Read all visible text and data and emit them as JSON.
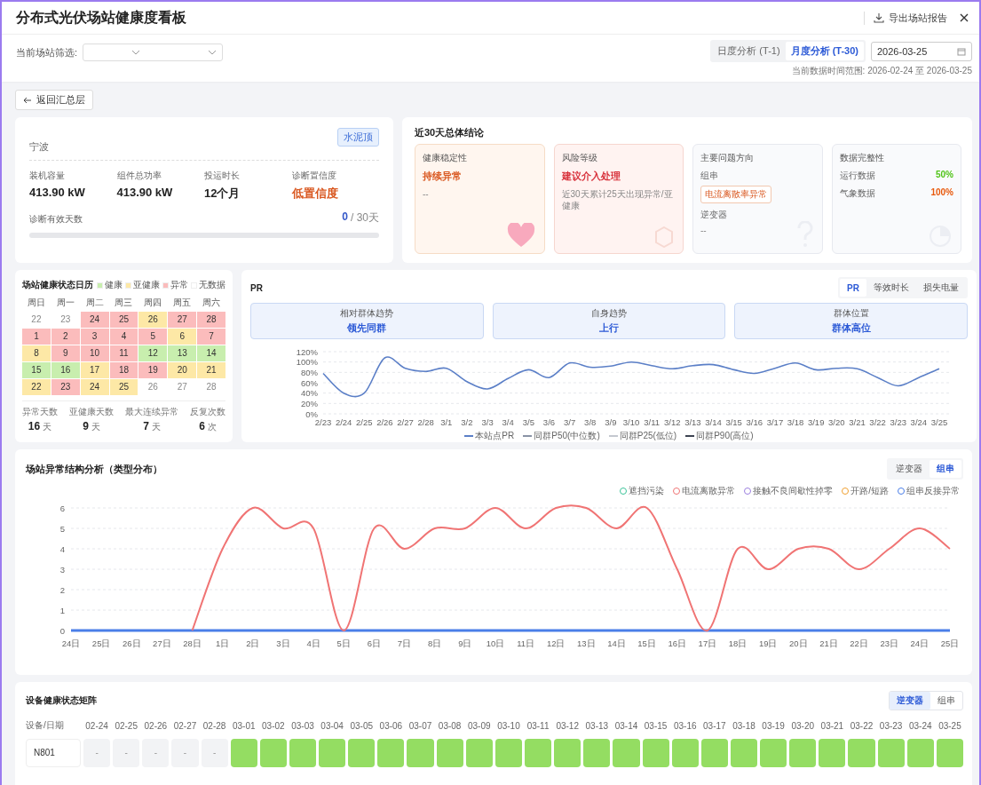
{
  "header": {
    "title": "分布式光伏场站健康度看板",
    "export_button": "导出场站报告"
  },
  "filter": {
    "label": "当前场站筛选:"
  },
  "period_tabs": [
    {
      "label": "日度分析 (T-1)",
      "selected": false
    },
    {
      "label": "月度分析 (T-30)",
      "selected": true
    }
  ],
  "date": "2026-03-25",
  "range_note": "当前数据时间范围: 2026-02-24 至 2026-03-25",
  "back_button": "返回汇总层",
  "station": {
    "name": "宁波",
    "tag": "水泥顶",
    "metrics": [
      {
        "label": "装机容量",
        "value": "413.90 kW",
        "kind": "normal"
      },
      {
        "label": "组件总功率",
        "value": "413.90 kW",
        "kind": "normal"
      },
      {
        "label": "投运时长",
        "value": "12个月",
        "kind": "normal"
      },
      {
        "label": "诊断置信度",
        "value": "低置信度",
        "kind": "warning"
      }
    ],
    "valid_days": {
      "label": "诊断有效天数",
      "count": "0",
      "total": "/ 30天"
    }
  },
  "conclusion": {
    "title": "近30天总体结论",
    "cards": [
      {
        "kind": "stability",
        "label": "健康稳定性",
        "value": "持续异常",
        "note": "--"
      },
      {
        "kind": "risk",
        "label": "风险等级",
        "value": "建议介入处理",
        "note": "近30天累计25天出现异常/亚健康"
      },
      {
        "kind": "issues",
        "label": "主要问题方向",
        "groups": [
          {
            "label": "组串",
            "tags": [
              "电流离散率异常"
            ]
          },
          {
            "label": "逆变器",
            "note": "--"
          }
        ]
      },
      {
        "kind": "completeness",
        "label": "数据完整性",
        "rows": [
          {
            "label": "运行数据",
            "value": "50%",
            "color": "#52c41a"
          },
          {
            "label": "气象数据",
            "value": "100%",
            "color": "#e8590c"
          }
        ]
      }
    ]
  },
  "calendar": {
    "title": "场站健康状态日历",
    "legend": [
      {
        "label": "健康",
        "color": "#c8eeae"
      },
      {
        "label": "亚健康",
        "color": "#fde8a6"
      },
      {
        "label": "异常",
        "color": "#fbbcbc"
      },
      {
        "label": "无数据",
        "color": "#ffffff"
      }
    ],
    "weekdays": [
      "周日",
      "周一",
      "周二",
      "周三",
      "周四",
      "周五",
      "周六"
    ],
    "weeks": [
      [
        {
          "day": "22",
          "kind": "none"
        },
        {
          "day": "23",
          "kind": "none"
        },
        {
          "day": "24",
          "kind": "abnormal"
        },
        {
          "day": "25",
          "kind": "abnormal"
        },
        {
          "day": "26",
          "kind": "sub"
        },
        {
          "day": "27",
          "kind": "abnormal"
        },
        {
          "day": "28",
          "kind": "abnormal"
        }
      ],
      [
        {
          "day": "1",
          "kind": "abnormal"
        },
        {
          "day": "2",
          "kind": "abnormal"
        },
        {
          "day": "3",
          "kind": "abnormal"
        },
        {
          "day": "4",
          "kind": "abnormal"
        },
        {
          "day": "5",
          "kind": "abnormal"
        },
        {
          "day": "6",
          "kind": "sub"
        },
        {
          "day": "7",
          "kind": "abnormal"
        }
      ],
      [
        {
          "day": "8",
          "kind": "sub"
        },
        {
          "day": "9",
          "kind": "abnormal"
        },
        {
          "day": "10",
          "kind": "abnormal"
        },
        {
          "day": "11",
          "kind": "abnormal"
        },
        {
          "day": "12",
          "kind": "healthy"
        },
        {
          "day": "13",
          "kind": "healthy"
        },
        {
          "day": "14",
          "kind": "healthy"
        }
      ],
      [
        {
          "day": "15",
          "kind": "healthy"
        },
        {
          "day": "16",
          "kind": "healthy"
        },
        {
          "day": "17",
          "kind": "sub"
        },
        {
          "day": "18",
          "kind": "abnormal"
        },
        {
          "day": "19",
          "kind": "abnormal"
        },
        {
          "day": "20",
          "kind": "sub"
        },
        {
          "day": "21",
          "kind": "sub"
        }
      ],
      [
        {
          "day": "22",
          "kind": "sub"
        },
        {
          "day": "23",
          "kind": "abnormal"
        },
        {
          "day": "24",
          "kind": "sub"
        },
        {
          "day": "25",
          "kind": "sub"
        },
        {
          "day": "26",
          "kind": "none"
        },
        {
          "day": "27",
          "kind": "none"
        },
        {
          "day": "28",
          "kind": "none"
        }
      ]
    ],
    "stats": [
      {
        "label": "异常天数",
        "value": "16",
        "unit": "天"
      },
      {
        "label": "亚健康天数",
        "value": "9",
        "unit": "天"
      },
      {
        "label": "最大连续异常",
        "value": "7",
        "unit": "天"
      },
      {
        "label": "反复次数",
        "value": "6",
        "unit": "次"
      }
    ]
  },
  "pr": {
    "title": "PR",
    "tabs": [
      {
        "label": "PR",
        "selected": true
      },
      {
        "label": "等效时长",
        "selected": false
      },
      {
        "label": "损失电量",
        "selected": false
      }
    ],
    "summary": [
      {
        "label": "相对群体趋势",
        "value": "领先同群"
      },
      {
        "label": "自身趋势",
        "value": "上行"
      },
      {
        "label": "群体位置",
        "value": "群体高位"
      }
    ],
    "chart_data": {
      "type": "line",
      "grid": true,
      "legend": "bottom",
      "categories": [
        "2/23",
        "2/24",
        "2/25",
        "2/26",
        "2/27",
        "2/28",
        "3/1",
        "3/2",
        "3/3",
        "3/4",
        "3/5",
        "3/6",
        "3/7",
        "3/8",
        "3/9",
        "3/10",
        "3/11",
        "3/12",
        "3/13",
        "3/14",
        "3/15",
        "3/16",
        "3/17",
        "3/18",
        "3/19",
        "3/20",
        "3/21",
        "3/22",
        "3/23",
        "3/24",
        "3/25"
      ],
      "series": [
        {
          "name": "本站点PR",
          "color": "#5b7fc7",
          "values": [
            78,
            40,
            40,
            108,
            88,
            82,
            88,
            62,
            48,
            68,
            85,
            70,
            98,
            90,
            92,
            100,
            93,
            87,
            93,
            95,
            85,
            78,
            88,
            98,
            85,
            88,
            87,
            70,
            54,
            70,
            87
          ]
        },
        {
          "name": "同群P50(中位数)",
          "color": "#8a93a6",
          "values": [
            null,
            null,
            null,
            null,
            null,
            null,
            null,
            null,
            null,
            null,
            null,
            null,
            null,
            null,
            null,
            null,
            null,
            null,
            null,
            null,
            null,
            null,
            null,
            null,
            null,
            null,
            null,
            null,
            null,
            null,
            null
          ]
        },
        {
          "name": "同群P25(低位)",
          "color": "#c4c8d0",
          "values": [
            null,
            null,
            null,
            null,
            null,
            null,
            null,
            null,
            null,
            null,
            null,
            null,
            null,
            null,
            null,
            null,
            null,
            null,
            null,
            null,
            null,
            null,
            null,
            null,
            null,
            null,
            null,
            null,
            null,
            null,
            null
          ]
        },
        {
          "name": "同群P90(高位)",
          "color": "#3d4352",
          "values": [
            null,
            null,
            null,
            null,
            null,
            null,
            null,
            null,
            null,
            null,
            null,
            null,
            null,
            null,
            null,
            null,
            null,
            null,
            null,
            null,
            null,
            null,
            null,
            null,
            null,
            null,
            null,
            null,
            null,
            null,
            null
          ]
        }
      ],
      "ylim": [
        0,
        120
      ],
      "yticks": [
        {
          "value": 0,
          "label": "0%"
        },
        {
          "value": 20,
          "label": "20%"
        },
        {
          "value": 40,
          "label": "40%"
        },
        {
          "value": 60,
          "label": "60%"
        },
        {
          "value": 80,
          "label": "80%"
        },
        {
          "value": 100,
          "label": "100%"
        },
        {
          "value": 120,
          "label": "120%"
        }
      ]
    }
  },
  "anomaly": {
    "title": "场站异常结构分析（类型分布）",
    "tabs": [
      {
        "label": "逆变器",
        "selected": false
      },
      {
        "label": "组串",
        "selected": true
      }
    ],
    "chart_data": {
      "type": "line",
      "grid": true,
      "legend": "top-right",
      "categories": [
        "24日",
        "25日",
        "26日",
        "27日",
        "28日",
        "1日",
        "2日",
        "3日",
        "4日",
        "5日",
        "6日",
        "7日",
        "8日",
        "9日",
        "10日",
        "11日",
        "12日",
        "13日",
        "14日",
        "15日",
        "16日",
        "17日",
        "18日",
        "19日",
        "20日",
        "21日",
        "22日",
        "23日",
        "24日",
        "25日"
      ],
      "series": [
        {
          "name": "遮挡污染",
          "color": "#3cc49a",
          "values": [
            null,
            null,
            null,
            null,
            null,
            null,
            null,
            null,
            null,
            null,
            null,
            null,
            null,
            null,
            null,
            null,
            null,
            null,
            null,
            null,
            null,
            null,
            null,
            null,
            null,
            null,
            null,
            null,
            null,
            null
          ]
        },
        {
          "name": "电流离散异常",
          "color": "#f07474",
          "values": [
            null,
            null,
            null,
            null,
            0,
            4,
            6,
            5,
            5,
            0,
            5,
            4,
            5,
            5,
            6,
            5,
            6,
            6,
            5,
            6,
            3,
            0,
            4,
            3,
            4,
            4,
            3,
            4,
            5,
            4
          ]
        },
        {
          "name": "接触不良间歇性掉零",
          "color": "#9b7fe0",
          "values": [
            null,
            null,
            null,
            null,
            null,
            null,
            null,
            null,
            null,
            null,
            null,
            null,
            null,
            null,
            null,
            null,
            null,
            null,
            null,
            null,
            null,
            null,
            null,
            null,
            null,
            null,
            null,
            null,
            null,
            null
          ]
        },
        {
          "name": "开路/短路",
          "color": "#f0a030",
          "values": [
            null,
            null,
            null,
            null,
            null,
            null,
            null,
            null,
            null,
            null,
            null,
            null,
            null,
            null,
            null,
            null,
            null,
            null,
            null,
            null,
            null,
            null,
            null,
            null,
            null,
            null,
            null,
            null,
            null,
            null
          ]
        },
        {
          "name": "组串反接异常",
          "color": "#4a7ee8",
          "values": [
            0,
            0,
            0,
            0,
            0,
            0,
            0,
            0,
            0,
            0,
            0,
            0,
            0,
            0,
            0,
            0,
            0,
            0,
            0,
            0,
            0,
            0,
            0,
            0,
            0,
            0,
            0,
            0,
            0,
            0
          ]
        }
      ],
      "ylim": [
        0,
        6
      ],
      "yticks": [
        0,
        1,
        2,
        3,
        4,
        5,
        6
      ]
    }
  },
  "matrix": {
    "title": "设备健康状态矩阵",
    "tabs": [
      {
        "label": "逆变器",
        "selected": true
      },
      {
        "label": "组串",
        "selected": false
      }
    ],
    "corner": "设备/日期",
    "dates": [
      "02-24",
      "02-25",
      "02-26",
      "02-27",
      "02-28",
      "03-01",
      "03-02",
      "03-03",
      "03-04",
      "03-05",
      "03-06",
      "03-07",
      "03-08",
      "03-09",
      "03-10",
      "03-11",
      "03-12",
      "03-13",
      "03-14",
      "03-15",
      "03-16",
      "03-17",
      "03-18",
      "03-19",
      "03-20",
      "03-21",
      "03-22",
      "03-23",
      "03-24",
      "03-25"
    ],
    "rows": [
      {
        "name": "N801",
        "cells": [
          {
            "kind": "none",
            "text": "-"
          },
          {
            "kind": "none",
            "text": "-"
          },
          {
            "kind": "none",
            "text": "-"
          },
          {
            "kind": "none",
            "text": "-"
          },
          {
            "kind": "none",
            "text": "-"
          },
          {
            "kind": "healthy"
          },
          {
            "kind": "healthy"
          },
          {
            "kind": "healthy"
          },
          {
            "kind": "healthy"
          },
          {
            "kind": "healthy"
          },
          {
            "kind": "healthy"
          },
          {
            "kind": "healthy"
          },
          {
            "kind": "healthy"
          },
          {
            "kind": "healthy"
          },
          {
            "kind": "healthy"
          },
          {
            "kind": "healthy"
          },
          {
            "kind": "healthy"
          },
          {
            "kind": "healthy"
          },
          {
            "kind": "healthy"
          },
          {
            "kind": "healthy"
          },
          {
            "kind": "healthy"
          },
          {
            "kind": "healthy"
          },
          {
            "kind": "healthy"
          },
          {
            "kind": "healthy"
          },
          {
            "kind": "healthy"
          },
          {
            "kind": "healthy"
          },
          {
            "kind": "healthy"
          },
          {
            "kind": "healthy"
          },
          {
            "kind": "healthy"
          },
          {
            "kind": "healthy"
          }
        ]
      }
    ]
  }
}
